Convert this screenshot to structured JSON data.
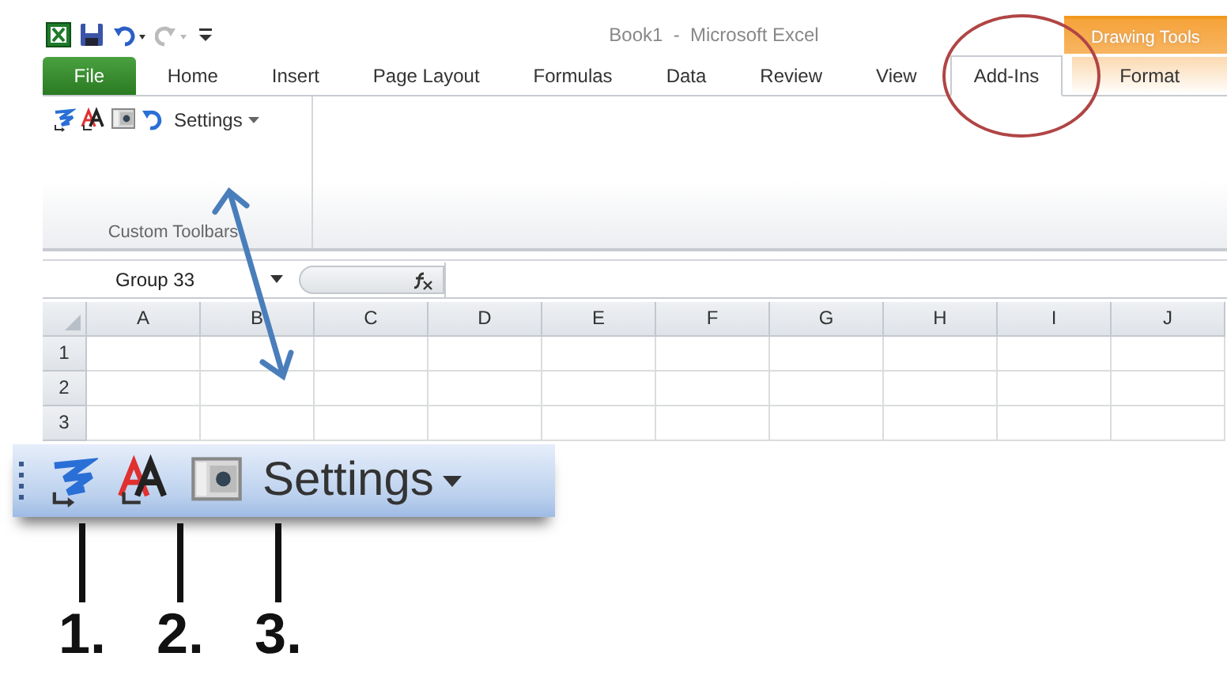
{
  "window": {
    "title": "Book1  -  Microsoft Excel"
  },
  "context_tabs": {
    "label": "Drawing Tools"
  },
  "tabs": [
    {
      "label": "File",
      "kind": "file",
      "selected": false
    },
    {
      "label": "Home",
      "kind": "normal",
      "selected": false
    },
    {
      "label": "Insert",
      "kind": "normal",
      "selected": false
    },
    {
      "label": "Page Layout",
      "kind": "normal",
      "selected": false
    },
    {
      "label": "Formulas",
      "kind": "normal",
      "selected": false
    },
    {
      "label": "Data",
      "kind": "normal",
      "selected": false
    },
    {
      "label": "Review",
      "kind": "normal",
      "selected": false
    },
    {
      "label": "View",
      "kind": "normal",
      "selected": false
    },
    {
      "label": "Add-Ins",
      "kind": "normal",
      "selected": true
    },
    {
      "label": "Format",
      "kind": "context",
      "selected": false
    }
  ],
  "ribbon_group": {
    "label": "Custom Toolbars",
    "settings_button": "Settings"
  },
  "name_box": {
    "value": "Group 33"
  },
  "sheet": {
    "columns": [
      "A",
      "B",
      "C",
      "D",
      "E",
      "F",
      "G",
      "H",
      "I",
      "J"
    ],
    "rows": [
      "1",
      "2",
      "3"
    ]
  },
  "zoomed_toolbar": {
    "settings_button": "Settings",
    "callouts": [
      "1.",
      "2.",
      "3."
    ]
  }
}
